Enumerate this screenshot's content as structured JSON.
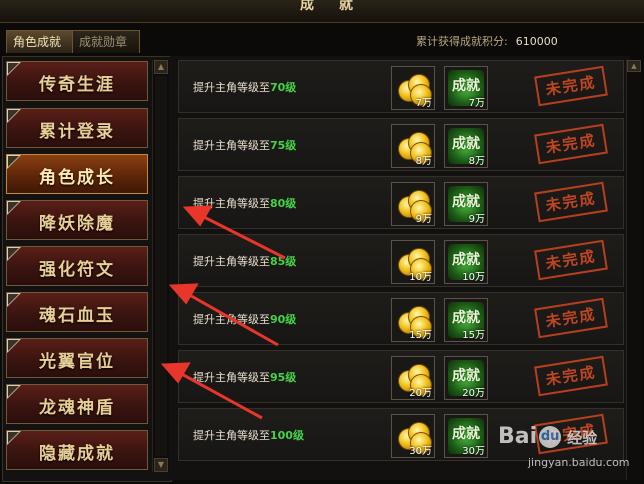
{
  "window": {
    "title": "成 就"
  },
  "tabs": [
    {
      "label": "角色成就",
      "active": true
    },
    {
      "label": "成就勋章",
      "active": false
    }
  ],
  "score": {
    "label": "累计获得成就积分:",
    "value": "610000"
  },
  "categories": [
    {
      "label": "传奇生涯",
      "selected": false
    },
    {
      "label": "累计登录",
      "selected": false
    },
    {
      "label": "角色成长",
      "selected": true
    },
    {
      "label": "降妖除魔",
      "selected": false
    },
    {
      "label": "强化符文",
      "selected": false
    },
    {
      "label": "魂石血玉",
      "selected": false
    },
    {
      "label": "光翼官位",
      "selected": false
    },
    {
      "label": "龙魂神盾",
      "selected": false
    },
    {
      "label": "隐藏成就",
      "selected": false
    }
  ],
  "achievements": [
    {
      "prefix": "提升主角等级至",
      "level": "70级",
      "gold": "7万",
      "points": "7万",
      "status": "未完成"
    },
    {
      "prefix": "提升主角等级至",
      "level": "75级",
      "gold": "8万",
      "points": "8万",
      "status": "未完成"
    },
    {
      "prefix": "提升主角等级至",
      "level": "80级",
      "gold": "9万",
      "points": "9万",
      "status": "未完成"
    },
    {
      "prefix": "提升主角等级至",
      "level": "85级",
      "gold": "10万",
      "points": "10万",
      "status": "未完成"
    },
    {
      "prefix": "提升主角等级至",
      "level": "90级",
      "gold": "15万",
      "points": "15万",
      "status": "未完成"
    },
    {
      "prefix": "提升主角等级至",
      "level": "95级",
      "gold": "20万",
      "points": "20万",
      "status": "未完成"
    },
    {
      "prefix": "提升主角等级至",
      "level": "100级",
      "gold": "30万",
      "points": "30万",
      "status": "未完成"
    }
  ],
  "achievement_icon_text": "成就",
  "watermark": {
    "brand_left": "Bai",
    "paw": "du",
    "brand_right": "经验",
    "sub": "jingyan.baidu.com"
  },
  "colors": {
    "level_green": "#45d248",
    "stamp_red": "#d24b24",
    "selected_category": "#8a3f12"
  }
}
